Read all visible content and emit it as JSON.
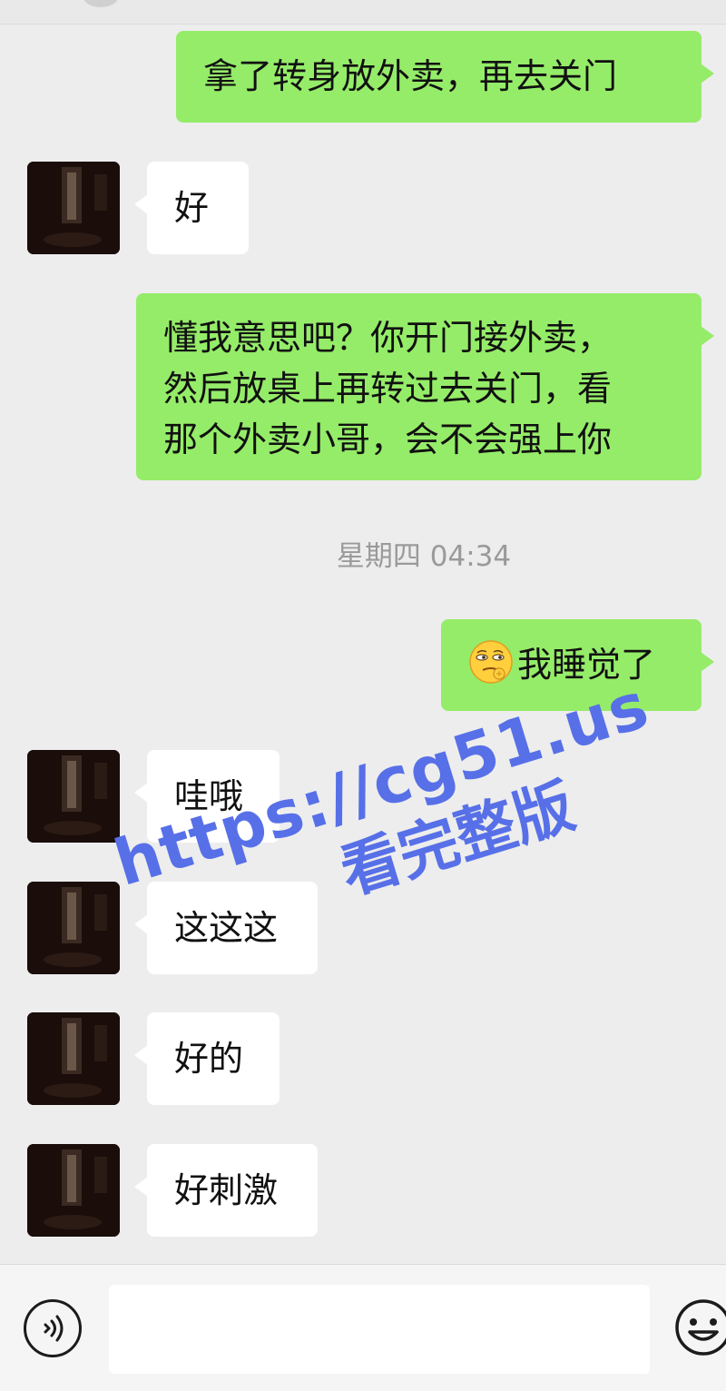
{
  "messages": [
    {
      "id": "m1",
      "side": "me",
      "text": "拿了转身放外卖，再去关门"
    },
    {
      "id": "m2",
      "side": "them",
      "text": "好"
    },
    {
      "id": "m3",
      "side": "me",
      "lines": [
        "懂我意思吧？你开门接外卖，",
        "然后放桌上再转过去关门，看",
        "那个外卖小哥，会不会强上你"
      ]
    },
    {
      "id": "m4",
      "side": "me",
      "emoji": "smirk-emoji",
      "text": "我睡觉了"
    },
    {
      "id": "m5",
      "side": "them",
      "text": "哇哦"
    },
    {
      "id": "m6",
      "side": "them",
      "text": "这这这"
    },
    {
      "id": "m7",
      "side": "them",
      "text": "好的"
    },
    {
      "id": "m8",
      "side": "them",
      "text": "好刺激"
    }
  ],
  "timestamp": "星期四 04:34",
  "watermark": {
    "url": "https://cg51.us",
    "subtitle": "看完整版"
  },
  "input_bar": {
    "voice_icon": "voice-input-icon",
    "emoji_icon": "emoji-icon",
    "input_value": ""
  },
  "colors": {
    "background": "#ededed",
    "my_bubble": "#95ec69",
    "their_bubble": "#ffffff",
    "timestamp_text": "#9a9a9a",
    "watermark": "#5770e8"
  }
}
